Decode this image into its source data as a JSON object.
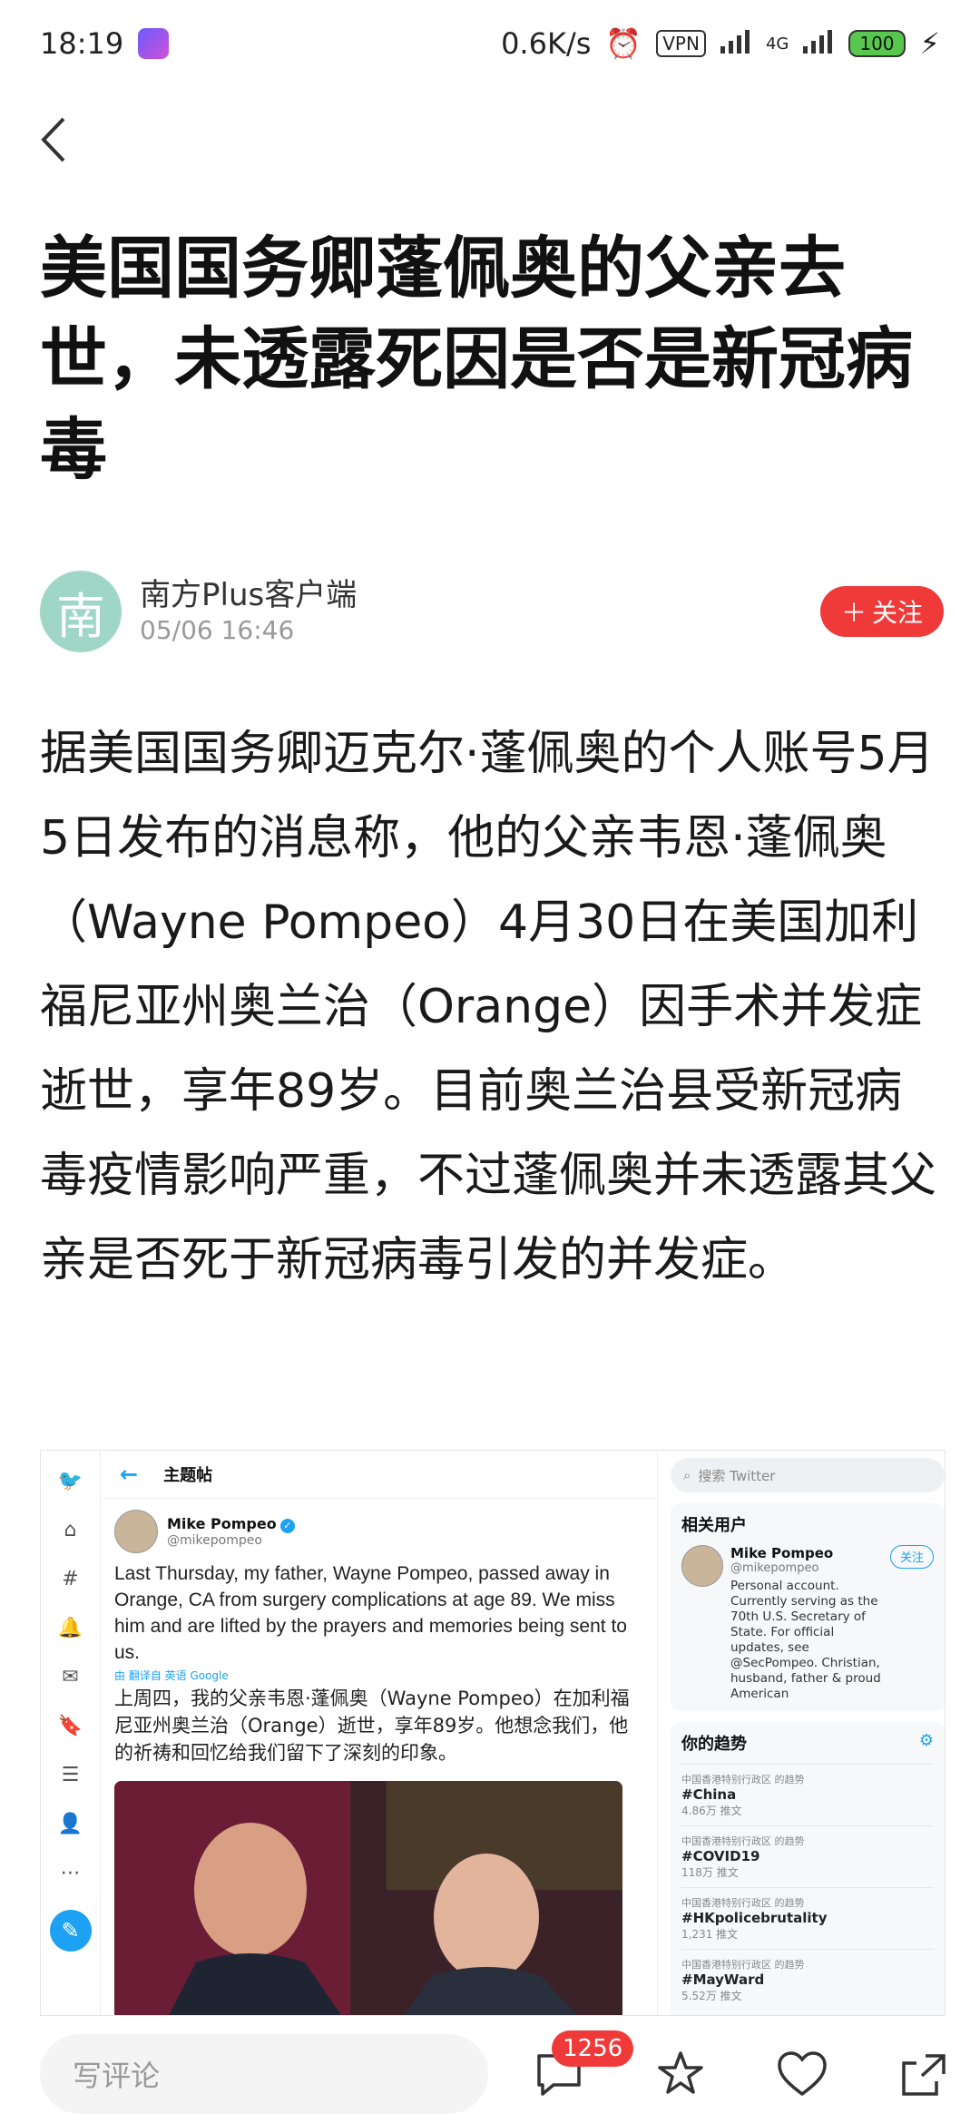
{
  "status_bar": {
    "time": "18:19",
    "network_speed": "0.6K/s",
    "vpn": "VPN",
    "network_type": "4G",
    "battery": "100"
  },
  "article": {
    "title": "美国国务卿蓬佩奥的父亲去世，未透露死因是否是新冠病毒",
    "author": {
      "name": "南方Plus客户端",
      "avatar_char": "南",
      "time": "05/06 16:46"
    },
    "follow_label": "关注",
    "body": "据美国国务卿迈克尔·蓬佩奥的个人账号5月5日发布的消息称，他的父亲韦恩·蓬佩奥（Wayne Pompeo）4月30日在美国加利福尼亚州奥兰治（Orange）因手术并发症逝世，享年89岁。目前奥兰治县受新冠病毒疫情影响严重，不过蓬佩奥并未透露其父亲是否死于新冠病毒引发的并发症。"
  },
  "embedded_screenshot": {
    "header_title": "主题帖",
    "tweet": {
      "name": "Mike Pompeo",
      "handle": "@mikepompeo",
      "text": "Last Thursday, my father, Wayne Pompeo, passed away in Orange, CA from surgery complications at age 89. We miss him and are lifted by the prayers and memories being sent to us.",
      "translation_label": "由 翻译自 英语 Google",
      "translation": "上周四，我的父亲韦恩·蓬佩奥（Wayne Pompeo）在加利福尼亚州奥兰治（Orange）逝世，享年89岁。他想念我们，他的祈祷和回忆给我们留下了深刻的印象。"
    },
    "search_placeholder": "搜索 Twitter",
    "related_users": {
      "title": "相关用户",
      "name": "Mike Pompeo",
      "handle": "@mikepompeo",
      "follow": "关注",
      "bio": "Personal account. Currently serving as the 70th U.S. Secretary of State. For official updates, see @SecPompeo. Christian, husband, father & proud American"
    },
    "trends": {
      "title": "你的趋势",
      "items": [
        {
          "meta": "中国香港特别行政区 的趋势",
          "tag": "#China",
          "count": "4.86万 推文"
        },
        {
          "meta": "中国香港特别行政区 的趋势",
          "tag": "#COVID19",
          "count": "118万 推文"
        },
        {
          "meta": "中国香港特别行政区 的趋势",
          "tag": "#HKpolicebrutality",
          "count": "1,231 推文"
        },
        {
          "meta": "中国香港特别行政区 的趋势",
          "tag": "#MayWard",
          "count": "5.52万 推文"
        }
      ]
    }
  },
  "bottom_bar": {
    "comment_placeholder": "写评论",
    "comment_count": "1256"
  },
  "colors": {
    "accent_red": "#f03a3a",
    "twitter_blue": "#1da1f2",
    "avatar_green": "#9fd6c7"
  }
}
